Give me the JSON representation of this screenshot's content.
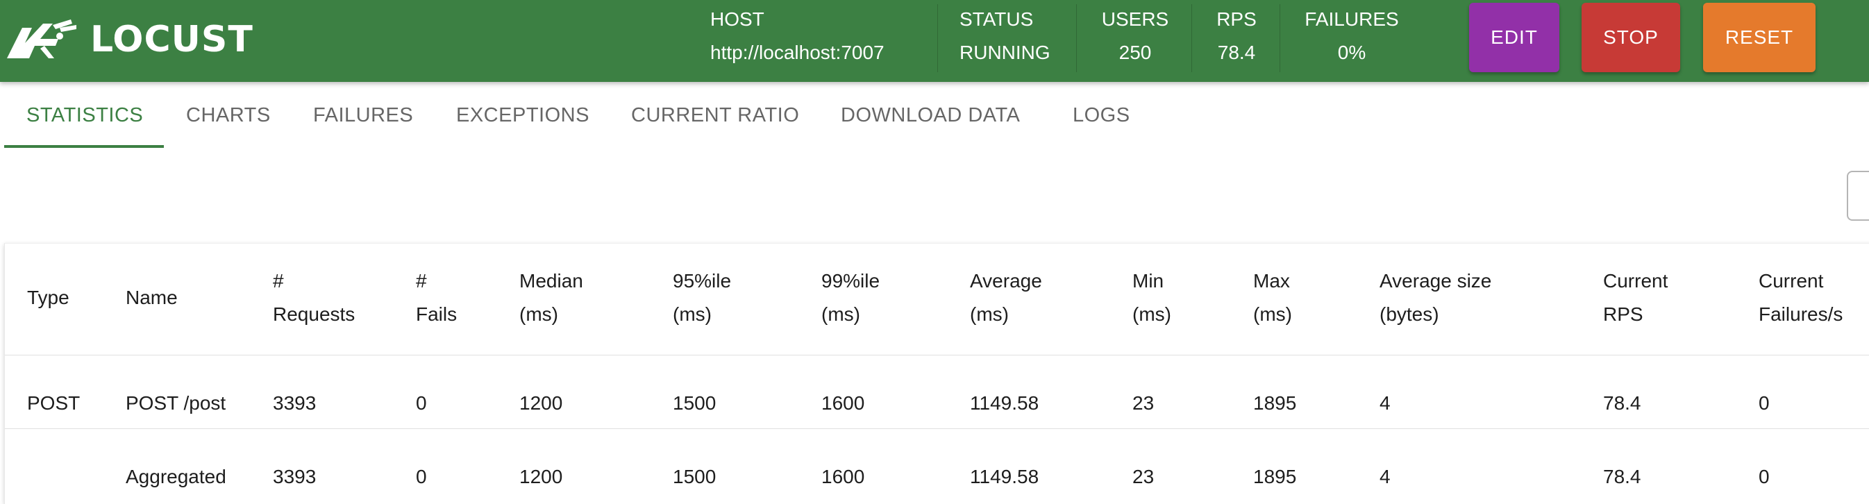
{
  "app": {
    "logo_text": "LOCUST"
  },
  "header": {
    "stats": [
      {
        "label": "HOST",
        "value": "http://localhost:7007"
      },
      {
        "label": "STATUS",
        "value": "RUNNING"
      },
      {
        "label": "USERS",
        "value": "250"
      },
      {
        "label": "RPS",
        "value": "78.4"
      },
      {
        "label": "FAILURES",
        "value": "0%"
      }
    ],
    "buttons": {
      "edit": "EDIT",
      "stop": "STOP",
      "reset": "RESET"
    },
    "colors": {
      "header_bg": "#3c8043",
      "edit": "#9230a8",
      "stop": "#c73a36",
      "reset": "#e57a2c"
    }
  },
  "tabs": [
    {
      "label": "STATISTICS",
      "active": true
    },
    {
      "label": "CHARTS",
      "active": false
    },
    {
      "label": "FAILURES",
      "active": false
    },
    {
      "label": "EXCEPTIONS",
      "active": false
    },
    {
      "label": "CURRENT RATIO",
      "active": false
    },
    {
      "label": "DOWNLOAD DATA",
      "active": false
    },
    {
      "label": "LOGS",
      "active": false
    }
  ],
  "table": {
    "columns": [
      [
        "Type"
      ],
      [
        "Name"
      ],
      [
        "#",
        "Requests"
      ],
      [
        "#",
        "Fails"
      ],
      [
        "Median",
        "(ms)"
      ],
      [
        "95%ile",
        "(ms)"
      ],
      [
        "99%ile",
        "(ms)"
      ],
      [
        "Average",
        "(ms)"
      ],
      [
        "Min",
        "(ms)"
      ],
      [
        "Max",
        "(ms)"
      ],
      [
        "Average size",
        "(bytes)"
      ],
      [
        "Current",
        "RPS"
      ],
      [
        "Current",
        "Failures/s"
      ]
    ],
    "rows": [
      [
        "POST",
        "POST /post",
        "3393",
        "0",
        "1200",
        "1500",
        "1600",
        "1149.58",
        "23",
        "1895",
        "4",
        "78.4",
        "0"
      ],
      [
        "",
        "Aggregated",
        "3393",
        "0",
        "1200",
        "1500",
        "1600",
        "1149.58",
        "23",
        "1895",
        "4",
        "78.4",
        "0"
      ]
    ]
  }
}
